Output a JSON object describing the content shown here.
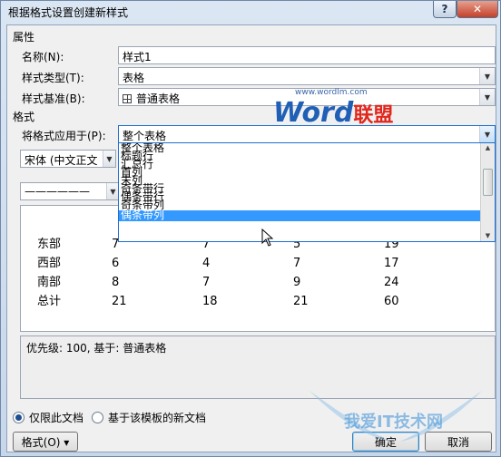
{
  "window": {
    "title": "根据格式设置创建新样式"
  },
  "properties": {
    "section_title": "属性",
    "name_label": "名称(N):",
    "name_value": "样式1",
    "type_label": "样式类型(T):",
    "type_value": "表格",
    "based_label": "样式基准(B):",
    "based_value": "普通表格"
  },
  "format": {
    "section_title": "格式",
    "apply_label": "将格式应用于(P):",
    "apply_value": "整个表格",
    "font_value": "宋体 (中文正文",
    "line_value": "——————"
  },
  "dropdown_options": [
    "整个表格",
    "标题行",
    "汇总行",
    "首列",
    "末列",
    "奇条带行",
    "偶条带行",
    "奇条带列",
    "偶条带列"
  ],
  "dropdown_selected_index": 8,
  "preview_table": [
    [
      "东部",
      "7",
      "7",
      "5",
      "19"
    ],
    [
      "西部",
      "6",
      "4",
      "7",
      "17"
    ],
    [
      "南部",
      "8",
      "7",
      "9",
      "24"
    ],
    [
      "总计",
      "21",
      "18",
      "21",
      "60"
    ]
  ],
  "description": "优先级: 100, 基于: 普通表格",
  "radios": {
    "this_doc": "仅限此文档",
    "template": "基于该模板的新文档",
    "selected": "this_doc"
  },
  "buttons": {
    "format": "格式(O) ▾",
    "ok": "确定",
    "cancel": "取消"
  },
  "titlebar": {
    "help": "?",
    "close": "✕"
  },
  "watermark": {
    "url": "www.wordlm.com",
    "brand": "Word",
    "brand_cn": "联盟",
    "bottom": "我爱IT技术网"
  },
  "colors": {
    "selection": "#3399ff",
    "brand_blue": "#1f5fb5",
    "brand_red": "#e1261c"
  }
}
